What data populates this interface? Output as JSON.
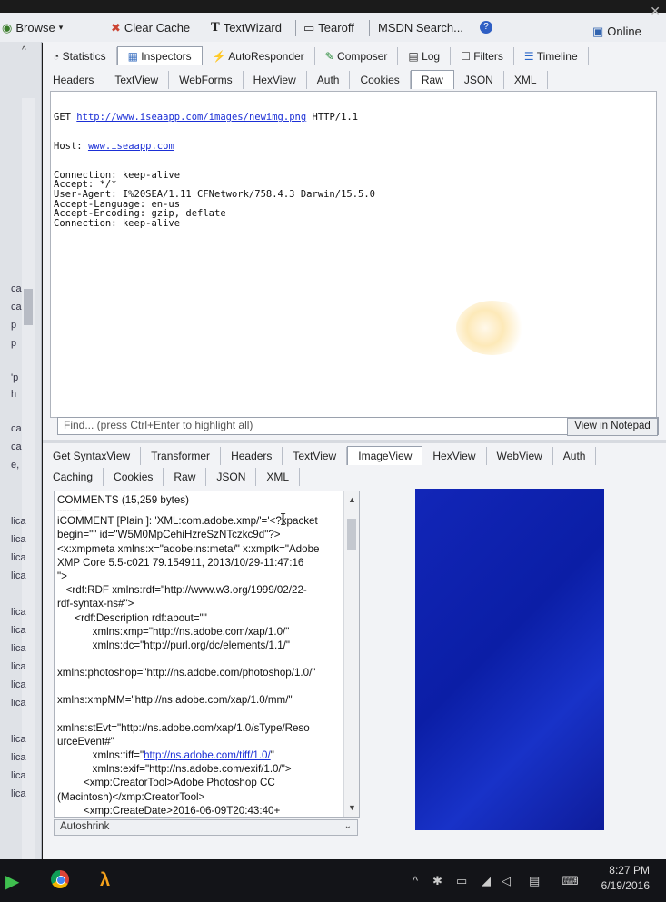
{
  "toolbar": {
    "browse": "Browse",
    "clear_cache": "Clear Cache",
    "textwizard": "TextWizard",
    "tearoff": "Tearoff",
    "msdn_search": "MSDN Search...",
    "online": "Online"
  },
  "left_strip": {
    "labels": [
      "ca",
      "ca",
      "p",
      "p",
      "'p",
      "h",
      "ca",
      "ca",
      "e,",
      "lica",
      "lica",
      "lica",
      "lica",
      "lica",
      "lica",
      "lica",
      "lica",
      "lica",
      "lica",
      "lica",
      "lica",
      "lica",
      "lica"
    ]
  },
  "top_tabs": [
    "Statistics",
    "Inspectors",
    "AutoResponder",
    "Composer",
    "Log",
    "Filters",
    "Timeline"
  ],
  "request_tabs": [
    "Headers",
    "TextView",
    "WebForms",
    "HexView",
    "Auth",
    "Cookies",
    "Raw",
    "JSON",
    "XML"
  ],
  "request": {
    "method": "GET",
    "url": "http://www.iseaapp.com/images/newimg.png",
    "protocol": "HTTP/1.1",
    "host_label": "Host:",
    "host": "www.iseaapp.com",
    "lines": [
      "Connection: keep-alive",
      "Accept: */*",
      "User-Agent: I%20SEA/1.11 CFNetwork/758.4.3 Darwin/15.5.0",
      "Accept-Language: en-us",
      "Accept-Encoding: gzip, deflate",
      "Connection: keep-alive"
    ]
  },
  "find": {
    "placeholder": "Find... (press Ctrl+Enter to highlight all)",
    "view_in_notepad": "View in Notepad"
  },
  "response_tabs_row1": [
    "Get SyntaxView",
    "Transformer",
    "Headers",
    "TextView",
    "ImageView",
    "HexView",
    "WebView",
    "Auth"
  ],
  "response_tabs_row2": [
    "Caching",
    "Cookies",
    "Raw",
    "JSON",
    "XML"
  ],
  "comments": {
    "title": "COMMENTS (15,259 bytes)",
    "divider": "----------",
    "lines": [
      "iCOMMENT [Plain ]: 'XML:com.adobe.xmp/'='<?xpacket",
      "begin=\"\" id=\"W5M0MpCehiHzreSzNTczkc9d\"?>",
      "<x:xmpmeta xmlns:x=\"adobe:ns:meta/\" x:xmptk=\"Adobe",
      "XMP Core 5.5-c021 79.154911, 2013/10/29-11:47:16",
      "\">",
      "   <rdf:RDF xmlns:rdf=\"http://www.w3.org/1999/02/22-",
      "rdf-syntax-ns#\">",
      "      <rdf:Description rdf:about=\"\"",
      "            xmlns:xmp=\"http://ns.adobe.com/xap/1.0/\"",
      "            xmlns:dc=\"http://purl.org/dc/elements/1.1/\"",
      "",
      "xmlns:photoshop=\"http://ns.adobe.com/photoshop/1.0/\"",
      "",
      "xmlns:xmpMM=\"http://ns.adobe.com/xap/1.0/mm/\"",
      "",
      "xmlns:stEvt=\"http://ns.adobe.com/xap/1.0/sType/Reso",
      "urceEvent#\""
    ],
    "tiff_prefix": "            xmlns:tiff=\"",
    "tiff_link": "http://ns.adobe.com/tiff/1.0/",
    "tiff_suffix": "\"",
    "lines_after": [
      "            xmlns:exif=\"http://ns.adobe.com/exif/1.0/\">",
      "         <xmp:CreatorTool>Adobe Photoshop CC",
      "(Macintosh)</xmp:CreatorTool>",
      "         <xmp:CreateDate>2016-06-09T20:43:40+"
    ]
  },
  "autoshrink": "Autoshrink",
  "clock": {
    "time": "8:27 PM",
    "date": "6/19/2016"
  },
  "colors": {
    "image_preview": "#1226b8",
    "link": "#1b2fd6"
  }
}
